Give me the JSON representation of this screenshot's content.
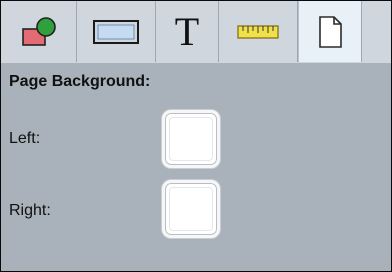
{
  "toolbar": {
    "tools": [
      {
        "icon": "shapes-icon"
      },
      {
        "icon": "rectangle-icon"
      },
      {
        "icon": "text-icon",
        "glyph": "T"
      },
      {
        "icon": "ruler-icon"
      },
      {
        "icon": "page-icon",
        "selected": true
      }
    ]
  },
  "panel": {
    "heading": "Page Background:",
    "rows": [
      {
        "label": "Left:",
        "color": "#ffffff"
      },
      {
        "label": "Right:",
        "color": "#ffffff"
      }
    ]
  },
  "colors": {
    "panel_background": "#a9b1ba",
    "toolbar_background": "#cfd6de",
    "selected_tab": "#e8f0f8"
  }
}
